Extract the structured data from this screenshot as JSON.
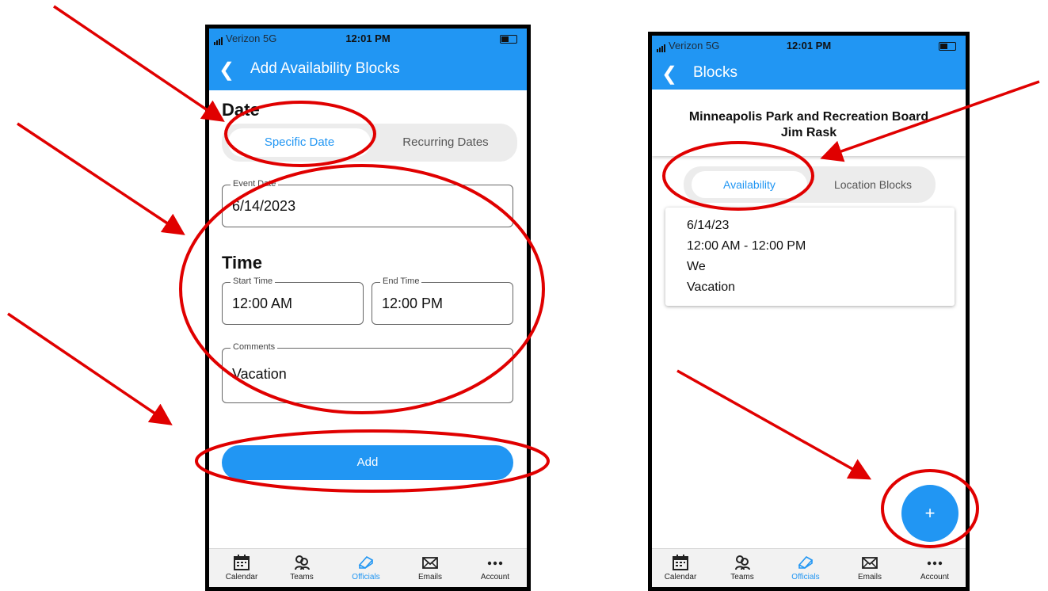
{
  "status": {
    "carrier": "Verizon 5G",
    "time": "12:01 PM"
  },
  "left": {
    "back_icon": "chevron-left-icon",
    "title": "Add Availability Blocks",
    "date_heading": "Date",
    "segment": {
      "selected": "Specific Date",
      "other": "Recurring Dates"
    },
    "event_date": {
      "label": "Event Date",
      "value": "6/14/2023"
    },
    "time_heading": "Time",
    "start_time": {
      "label": "Start Time",
      "value": "12:00 AM"
    },
    "end_time": {
      "label": "End Time",
      "value": "12:00 PM"
    },
    "comments": {
      "label": "Comments",
      "value": "Vacation"
    },
    "add_label": "Add"
  },
  "right": {
    "back_icon": "chevron-left-icon",
    "title": "Blocks",
    "org_name": "Minneapolis Park and Recreation Board",
    "person_name": "Jim Rask",
    "segment": {
      "selected": "Availability",
      "other": "Location Blocks"
    },
    "block": {
      "date": "6/14/23",
      "time_range": "12:00 AM - 12:00 PM",
      "days": "We",
      "comment": "Vacation"
    },
    "fab_label": "+"
  },
  "tabs": [
    {
      "label": "Calendar",
      "icon": "calendar-icon"
    },
    {
      "label": "Teams",
      "icon": "people-icon"
    },
    {
      "label": "Officials",
      "icon": "eraser-icon"
    },
    {
      "label": "Emails",
      "icon": "envelope-icon"
    },
    {
      "label": "Account",
      "icon": "ellipsis-icon"
    }
  ],
  "colors": {
    "accent": "#2196F3",
    "annotation": "#e00000"
  }
}
